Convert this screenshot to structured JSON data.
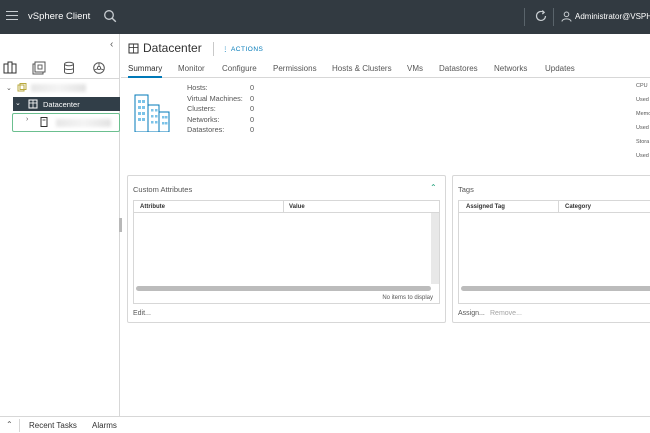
{
  "topbar": {
    "app_title": "vSphere Client",
    "user": "Administrator@VSPHERE"
  },
  "nav": {
    "icons": [
      "hosts-and-clusters-icon",
      "vms-and-templates-icon",
      "storage-icon",
      "networking-icon"
    ],
    "tree": {
      "root_label": "",
      "datacenter_label": "Datacenter",
      "host_label": ""
    }
  },
  "header": {
    "title": "Datacenter",
    "actions_label": "ACTIONS"
  },
  "tabs": [
    "Summary",
    "Monitor",
    "Configure",
    "Permissions",
    "Hosts & Clusters",
    "VMs",
    "Datastores",
    "Networks",
    "Updates"
  ],
  "active_tab": "Summary",
  "stats": [
    {
      "label": "Hosts:",
      "value": "0"
    },
    {
      "label": "Virtual Machines:",
      "value": "0"
    },
    {
      "label": "Clusters:",
      "value": "0"
    },
    {
      "label": "Networks:",
      "value": "0"
    },
    {
      "label": "Datastores:",
      "value": "0"
    }
  ],
  "resources": {
    "cpu_label": "CPU",
    "cpu_used_label": "Used",
    "memory_label": "Memo",
    "memory_used_label": "Used",
    "storage_label": "Stora",
    "storage_used_label": "Used"
  },
  "custom_attributes": {
    "title": "Custom Attributes",
    "columns": [
      "Attribute",
      "Value"
    ],
    "footer": "No items to display",
    "edit_label": "Edit..."
  },
  "tags": {
    "title": "Tags",
    "columns": [
      "Assigned Tag",
      "Category"
    ],
    "assign_label": "Assign...",
    "remove_label": "Remove..."
  },
  "bottombar": {
    "recent_tasks": "Recent Tasks",
    "alarms": "Alarms"
  },
  "colors": {
    "topbar_bg": "#323a41",
    "accent": "#0079b8",
    "selected_row": "#313e48",
    "highlight": "#6bbf8f"
  }
}
